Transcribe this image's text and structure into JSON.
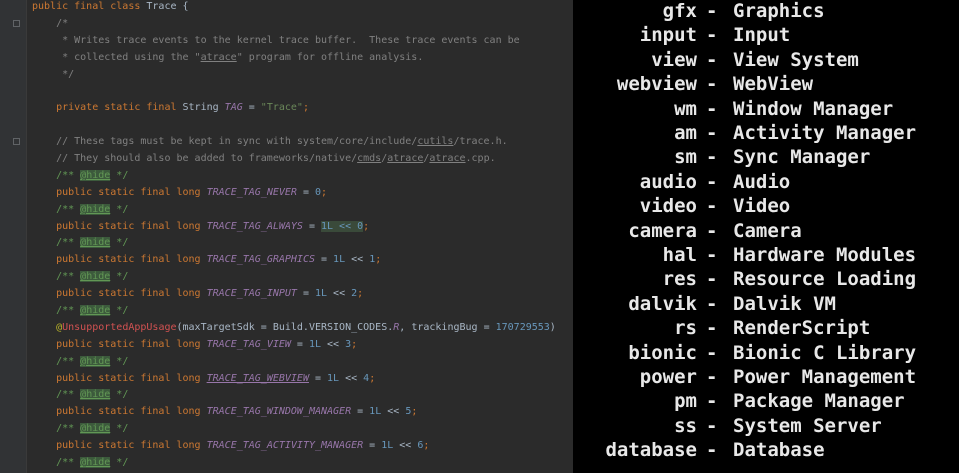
{
  "editor": {
    "lines": [
      [
        {
          "c": "kw",
          "t": "public final class "
        },
        {
          "c": "",
          "t": "Trace {"
        }
      ],
      [
        {
          "c": "cm",
          "t": "    /*"
        }
      ],
      [
        {
          "c": "cm",
          "t": "     * Writes trace events to the kernel trace buffer.  These trace events can be"
        }
      ],
      [
        {
          "c": "cm",
          "t": "     * collected using the \""
        },
        {
          "c": "cm ul",
          "t": "atrace"
        },
        {
          "c": "cm",
          "t": "\" program for offline analysis."
        }
      ],
      [
        {
          "c": "cm",
          "t": "     */"
        }
      ],
      [
        {
          "c": "",
          "t": ""
        }
      ],
      [
        {
          "c": "kw",
          "t": "    private static final "
        },
        {
          "c": "",
          "t": "String "
        },
        {
          "c": "fld",
          "t": "TAG"
        },
        {
          "c": "",
          "t": " = "
        },
        {
          "c": "str",
          "t": "\"Trace\""
        },
        {
          "c": "kw",
          "t": ";"
        }
      ],
      [
        {
          "c": "",
          "t": ""
        }
      ],
      [
        {
          "c": "cm",
          "t": "    // These tags must be kept in sync with system/core/include/"
        },
        {
          "c": "cm ul",
          "t": "cutils"
        },
        {
          "c": "cm",
          "t": "/trace.h."
        }
      ],
      [
        {
          "c": "cm",
          "t": "    // They should also be added to frameworks/native/"
        },
        {
          "c": "cm ul",
          "t": "cmds"
        },
        {
          "c": "cm",
          "t": "/"
        },
        {
          "c": "cm ul",
          "t": "atrace"
        },
        {
          "c": "cm",
          "t": "/"
        },
        {
          "c": "cm ul",
          "t": "atrace"
        },
        {
          "c": "cm",
          "t": ".cpp."
        }
      ],
      [
        {
          "c": "dc",
          "t": "    /** "
        },
        {
          "c": "tg",
          "t": "@hide"
        },
        {
          "c": "dc",
          "t": " */"
        }
      ],
      [
        {
          "c": "kw",
          "t": "    public static final long "
        },
        {
          "c": "fld",
          "t": "TRACE_TAG_NEVER"
        },
        {
          "c": "",
          "t": " = "
        },
        {
          "c": "num",
          "t": "0"
        },
        {
          "c": "kw",
          "t": ";"
        }
      ],
      [
        {
          "c": "dc",
          "t": "    /** "
        },
        {
          "c": "tg",
          "t": "@hide"
        },
        {
          "c": "dc",
          "t": " */"
        }
      ],
      [
        {
          "c": "kw",
          "t": "    public static final long "
        },
        {
          "c": "fld",
          "t": "TRACE_TAG_ALWAYS"
        },
        {
          "c": "",
          "t": " = "
        },
        {
          "c": "num hl",
          "t": "1L << 0"
        },
        {
          "c": "kw",
          "t": ";"
        }
      ],
      [
        {
          "c": "dc",
          "t": "    /** "
        },
        {
          "c": "tg",
          "t": "@hide"
        },
        {
          "c": "dc",
          "t": " */"
        }
      ],
      [
        {
          "c": "kw",
          "t": "    public static final long "
        },
        {
          "c": "fld",
          "t": "TRACE_TAG_GRAPHICS"
        },
        {
          "c": "",
          "t": " = "
        },
        {
          "c": "num",
          "t": "1L"
        },
        {
          "c": "",
          "t": " << "
        },
        {
          "c": "num",
          "t": "1"
        },
        {
          "c": "kw",
          "t": ";"
        }
      ],
      [
        {
          "c": "dc",
          "t": "    /** "
        },
        {
          "c": "tg",
          "t": "@hide"
        },
        {
          "c": "dc",
          "t": " */"
        }
      ],
      [
        {
          "c": "kw",
          "t": "    public static final long "
        },
        {
          "c": "fld",
          "t": "TRACE_TAG_INPUT"
        },
        {
          "c": "",
          "t": " = "
        },
        {
          "c": "num",
          "t": "1L"
        },
        {
          "c": "",
          "t": " << "
        },
        {
          "c": "num",
          "t": "2"
        },
        {
          "c": "kw",
          "t": ";"
        }
      ],
      [
        {
          "c": "dc",
          "t": "    /** "
        },
        {
          "c": "tg",
          "t": "@hide"
        },
        {
          "c": "dc",
          "t": " */"
        }
      ],
      [
        {
          "c": "ann",
          "t": "    @"
        },
        {
          "c": "red",
          "t": "UnsupportedAppUsage"
        },
        {
          "c": "",
          "t": "(maxTargetSdk = Build.VERSION_CODES."
        },
        {
          "c": "fld",
          "t": "R"
        },
        {
          "c": "",
          "t": ", trackingBug = "
        },
        {
          "c": "num",
          "t": "170729553"
        },
        {
          "c": "",
          "t": ")"
        }
      ],
      [
        {
          "c": "kw",
          "t": "    public static final long "
        },
        {
          "c": "fld",
          "t": "TRACE_TAG_VIEW"
        },
        {
          "c": "",
          "t": " = "
        },
        {
          "c": "num",
          "t": "1L"
        },
        {
          "c": "",
          "t": " << "
        },
        {
          "c": "num",
          "t": "3"
        },
        {
          "c": "kw",
          "t": ";"
        }
      ],
      [
        {
          "c": "dc",
          "t": "    /** "
        },
        {
          "c": "tg",
          "t": "@hide"
        },
        {
          "c": "dc",
          "t": " */"
        }
      ],
      [
        {
          "c": "kw",
          "t": "    public static final long "
        },
        {
          "c": "fld ul",
          "t": "TRACE_TAG_WEBVIEW"
        },
        {
          "c": "",
          "t": " = "
        },
        {
          "c": "num",
          "t": "1L"
        },
        {
          "c": "",
          "t": " << "
        },
        {
          "c": "num",
          "t": "4"
        },
        {
          "c": "kw",
          "t": ";"
        }
      ],
      [
        {
          "c": "dc",
          "t": "    /** "
        },
        {
          "c": "tg",
          "t": "@hide"
        },
        {
          "c": "dc",
          "t": " */"
        }
      ],
      [
        {
          "c": "kw",
          "t": "    public static final long "
        },
        {
          "c": "fld",
          "t": "TRACE_TAG_WINDOW_MANAGER"
        },
        {
          "c": "",
          "t": " = "
        },
        {
          "c": "num",
          "t": "1L"
        },
        {
          "c": "",
          "t": " << "
        },
        {
          "c": "num",
          "t": "5"
        },
        {
          "c": "kw",
          "t": ";"
        }
      ],
      [
        {
          "c": "dc",
          "t": "    /** "
        },
        {
          "c": "tg",
          "t": "@hide"
        },
        {
          "c": "dc",
          "t": " */"
        }
      ],
      [
        {
          "c": "kw",
          "t": "    public static final long "
        },
        {
          "c": "fld",
          "t": "TRACE_TAG_ACTIVITY_MANAGER"
        },
        {
          "c": "",
          "t": " = "
        },
        {
          "c": "num",
          "t": "1L"
        },
        {
          "c": "",
          "t": " << "
        },
        {
          "c": "num",
          "t": "6"
        },
        {
          "c": "kw",
          "t": ";"
        }
      ],
      [
        {
          "c": "dc",
          "t": "    /** "
        },
        {
          "c": "tg",
          "t": "@hide"
        },
        {
          "c": "dc",
          "t": " */"
        }
      ]
    ]
  },
  "terminal": {
    "separator": "-",
    "rows": [
      {
        "cat": "gfx",
        "desc": "Graphics"
      },
      {
        "cat": "input",
        "desc": "Input"
      },
      {
        "cat": "view",
        "desc": "View System"
      },
      {
        "cat": "webview",
        "desc": "WebView"
      },
      {
        "cat": "wm",
        "desc": "Window Manager"
      },
      {
        "cat": "am",
        "desc": "Activity Manager"
      },
      {
        "cat": "sm",
        "desc": "Sync Manager"
      },
      {
        "cat": "audio",
        "desc": "Audio"
      },
      {
        "cat": "video",
        "desc": "Video"
      },
      {
        "cat": "camera",
        "desc": "Camera"
      },
      {
        "cat": "hal",
        "desc": "Hardware Modules"
      },
      {
        "cat": "res",
        "desc": "Resource Loading"
      },
      {
        "cat": "dalvik",
        "desc": "Dalvik VM"
      },
      {
        "cat": "rs",
        "desc": "RenderScript"
      },
      {
        "cat": "bionic",
        "desc": "Bionic C Library"
      },
      {
        "cat": "power",
        "desc": "Power Management"
      },
      {
        "cat": "pm",
        "desc": "Package Manager"
      },
      {
        "cat": "ss",
        "desc": "System Server"
      },
      {
        "cat": "database",
        "desc": "Database"
      }
    ]
  }
}
